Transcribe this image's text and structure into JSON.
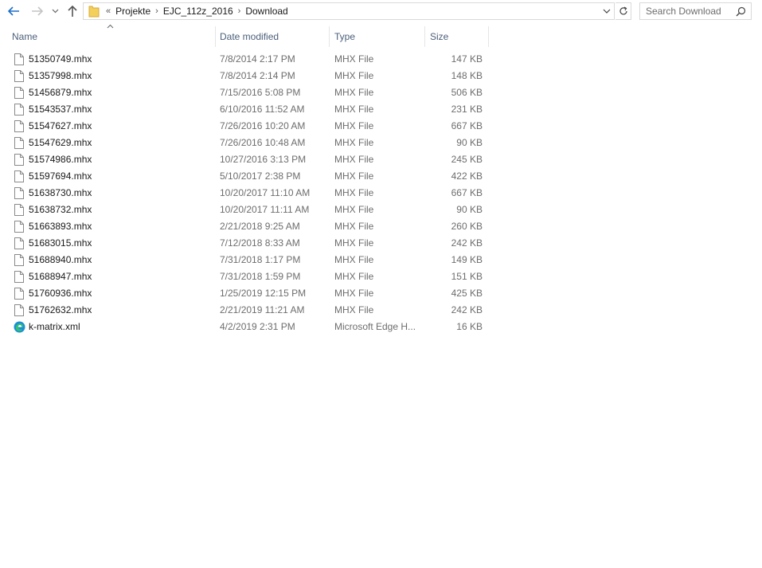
{
  "nav": {
    "back_icon": "back-arrow-icon",
    "forward_icon": "forward-arrow-icon",
    "recent_icon": "chevron-down-icon",
    "up_icon": "up-arrow-icon"
  },
  "address": {
    "overflow": "«",
    "crumbs": [
      "Projekte",
      "EJC_112z_2016",
      "Download"
    ]
  },
  "search": {
    "placeholder": "Search Download"
  },
  "columns": {
    "name": "Name",
    "date": "Date modified",
    "type": "Type",
    "size": "Size"
  },
  "files": [
    {
      "name": "51350749.mhx",
      "date": "7/8/2014 2:17 PM",
      "type": "MHX File",
      "size": "147 KB",
      "icon": "file-icon"
    },
    {
      "name": "51357998.mhx",
      "date": "7/8/2014 2:14 PM",
      "type": "MHX File",
      "size": "148 KB",
      "icon": "file-icon"
    },
    {
      "name": "51456879.mhx",
      "date": "7/15/2016 5:08 PM",
      "type": "MHX File",
      "size": "506 KB",
      "icon": "file-icon"
    },
    {
      "name": "51543537.mhx",
      "date": "6/10/2016 11:52 AM",
      "type": "MHX File",
      "size": "231 KB",
      "icon": "file-icon"
    },
    {
      "name": "51547627.mhx",
      "date": "7/26/2016 10:20 AM",
      "type": "MHX File",
      "size": "667 KB",
      "icon": "file-icon"
    },
    {
      "name": "51547629.mhx",
      "date": "7/26/2016 10:48 AM",
      "type": "MHX File",
      "size": "90 KB",
      "icon": "file-icon"
    },
    {
      "name": "51574986.mhx",
      "date": "10/27/2016 3:13 PM",
      "type": "MHX File",
      "size": "245 KB",
      "icon": "file-icon"
    },
    {
      "name": "51597694.mhx",
      "date": "5/10/2017 2:38 PM",
      "type": "MHX File",
      "size": "422 KB",
      "icon": "file-icon"
    },
    {
      "name": "51638730.mhx",
      "date": "10/20/2017 11:10 AM",
      "type": "MHX File",
      "size": "667 KB",
      "icon": "file-icon"
    },
    {
      "name": "51638732.mhx",
      "date": "10/20/2017 11:11 AM",
      "type": "MHX File",
      "size": "90 KB",
      "icon": "file-icon"
    },
    {
      "name": "51663893.mhx",
      "date": "2/21/2018 9:25 AM",
      "type": "MHX File",
      "size": "260 KB",
      "icon": "file-icon"
    },
    {
      "name": "51683015.mhx",
      "date": "7/12/2018 8:33 AM",
      "type": "MHX File",
      "size": "242 KB",
      "icon": "file-icon"
    },
    {
      "name": "51688940.mhx",
      "date": "7/31/2018 1:17 PM",
      "type": "MHX File",
      "size": "149 KB",
      "icon": "file-icon"
    },
    {
      "name": "51688947.mhx",
      "date": "7/31/2018 1:59 PM",
      "type": "MHX File",
      "size": "151 KB",
      "icon": "file-icon"
    },
    {
      "name": "51760936.mhx",
      "date": "1/25/2019 12:15 PM",
      "type": "MHX File",
      "size": "425 KB",
      "icon": "file-icon"
    },
    {
      "name": "51762632.mhx",
      "date": "2/21/2019 11:21 AM",
      "type": "MHX File",
      "size": "242 KB",
      "icon": "file-icon"
    },
    {
      "name": "k-matrix.xml",
      "date": "4/2/2019 2:31 PM",
      "type": "Microsoft Edge H...",
      "size": "16 KB",
      "icon": "edge-icon"
    }
  ],
  "colors": {
    "accent": "#1e6fc9",
    "header_text": "#4c607a",
    "muted_text": "#6d6d6d",
    "border": "#d9d9d9"
  }
}
